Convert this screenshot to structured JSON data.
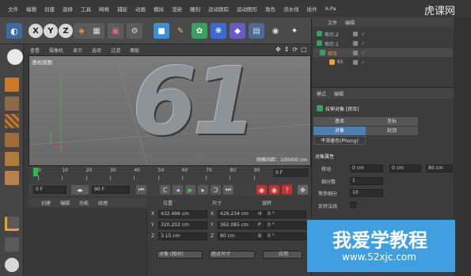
{
  "menubar": {
    "items": [
      "文件",
      "编辑",
      "创建",
      "选择",
      "工具",
      "网格",
      "捕捉",
      "动画",
      "模拟",
      "渲染",
      "雕刻",
      "运动跟踪",
      "运动图形",
      "角色",
      "流水线",
      "插件",
      "X-Pa"
    ]
  },
  "toolbar": {
    "x_label": "X",
    "y_label": "Y",
    "z_label": "Z"
  },
  "viewport": {
    "menu": [
      "查看",
      "摄像机",
      "显示",
      "选项",
      "过滤",
      "面板"
    ],
    "label": "透视视图",
    "grid_readout": "网格间距：100000 cm",
    "model_text": "61"
  },
  "timeline": {
    "ticks": [
      "0",
      "10",
      "20",
      "30",
      "40",
      "50",
      "60",
      "70",
      "80",
      "90"
    ],
    "end_frame": "0 F"
  },
  "transport": {
    "start_field": "0 F",
    "end_field": "90 F"
  },
  "material": {
    "menu": [
      "创建",
      "编辑",
      "功能",
      "纹理"
    ]
  },
  "coords": {
    "headers": {
      "position": "位置",
      "size": "尺寸",
      "rotation": "旋转"
    },
    "rows": [
      {
        "axis": "X",
        "pos": "432.496 cm",
        "size_axis": "X",
        "size": "426.234 cm",
        "rot_axis": "H",
        "rot": "0 °"
      },
      {
        "axis": "Y",
        "pos": "320.202 cm",
        "size_axis": "Y",
        "size": "362.085 cm",
        "rot_axis": "P",
        "rot": "0 °"
      },
      {
        "axis": "Z",
        "pos": "3.15 cm",
        "size_axis": "Z",
        "size": "80 cm",
        "rot_axis": "B",
        "rot": "0 °"
      }
    ],
    "mode_object": "对象 (相对)",
    "mode_size": "绝对尺寸",
    "apply": "应用"
  },
  "objects": {
    "menu": [
      "文件",
      "编辑"
    ],
    "items": [
      "布尔.2",
      "布尔.1",
      "挤压",
      "61"
    ]
  },
  "attributes": {
    "menu": [
      "模式",
      "编辑"
    ],
    "object_title": "拉伸对象 [挤压]",
    "tabs": [
      "基本",
      "坐标",
      "对象",
      "封顶",
      "平滑着色(Phong)"
    ],
    "section": "对象属性",
    "move_label": "移动",
    "move_values": [
      "0 cm",
      "0 cm",
      "80 cm"
    ],
    "subdiv_label": "细分数",
    "subdiv_value": "1",
    "iso_label": "等参细分",
    "iso_value": "10",
    "flip_label": "反转法线"
  },
  "watermark": {
    "title": "我爱学教程",
    "url": "www.52xjc.com",
    "brand": "虎课网"
  }
}
